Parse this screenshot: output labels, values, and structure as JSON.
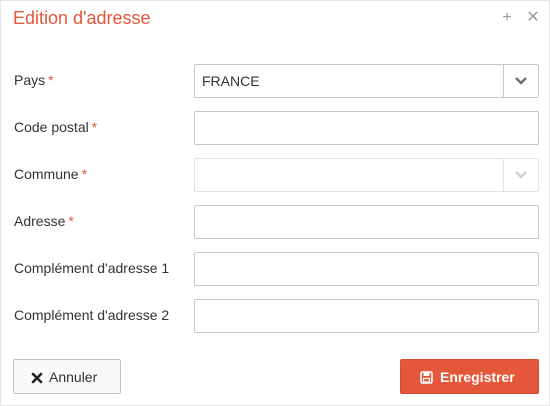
{
  "dialog": {
    "title": "Edition d'adresse",
    "add_icon": "plus-icon",
    "close_icon": "close-icon"
  },
  "form": {
    "required_mark": "*",
    "pays": {
      "label": "Pays",
      "value": "FRANCE",
      "required": true
    },
    "code_postal": {
      "label": "Code postal",
      "value": "",
      "required": true
    },
    "commune": {
      "label": "Commune",
      "value": "",
      "required": true,
      "disabled": true
    },
    "adresse": {
      "label": "Adresse",
      "value": "",
      "required": true
    },
    "complement1": {
      "label": "Complément d'adresse 1",
      "value": "",
      "required": false
    },
    "complement2": {
      "label": "Complément d'adresse 2",
      "value": "",
      "required": false
    }
  },
  "buttons": {
    "cancel": {
      "label": "Annuler",
      "icon": "x-icon"
    },
    "save": {
      "label": "Enregistrer",
      "icon": "floppy-disk-icon"
    }
  },
  "colors": {
    "accent": "#e4573a",
    "text": "#333333"
  }
}
